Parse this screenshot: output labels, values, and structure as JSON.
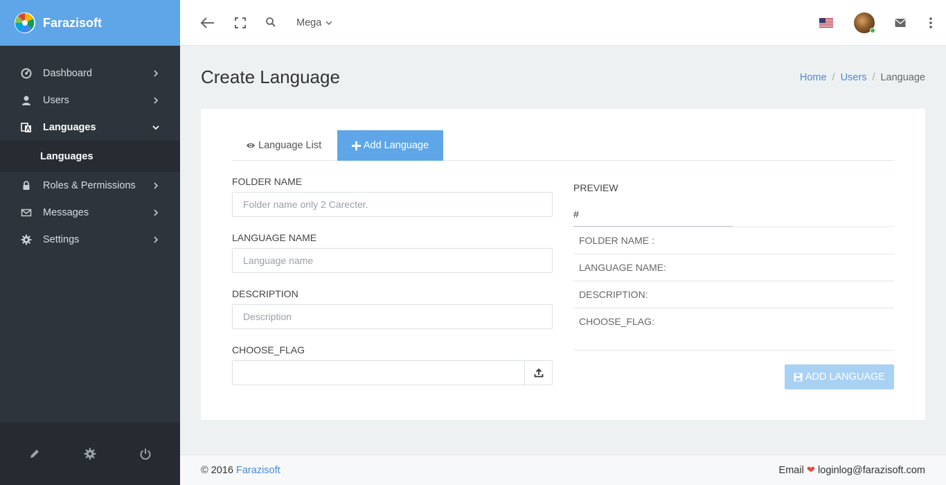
{
  "brand": {
    "name": "Farazisoft"
  },
  "sidebar": {
    "items": [
      {
        "label": "Dashboard",
        "icon": "dashboard-icon"
      },
      {
        "label": "Users",
        "icon": "user-icon"
      },
      {
        "label": "Languages",
        "icon": "language-icon",
        "active": true
      },
      {
        "label": "Roles & Permissions",
        "icon": "lock-icon"
      },
      {
        "label": "Messages",
        "icon": "envelope-icon"
      },
      {
        "label": "Settings",
        "icon": "gear-icon"
      }
    ],
    "sub_item": "Languages",
    "footer_icons": [
      "pencil-icon",
      "gear-icon",
      "power-icon"
    ]
  },
  "topbar": {
    "mega_label": "Mega"
  },
  "page": {
    "title": "Create Language"
  },
  "breadcrumb": {
    "home": "Home",
    "users": "Users",
    "current": "Language",
    "separator": "/"
  },
  "tabs": {
    "list": "Language List",
    "add": "Add Language"
  },
  "form": {
    "folder_label": "FOLDER NAME",
    "folder_placeholder": "Folder name only 2 Carecter.",
    "language_label": "LANGUAGE NAME",
    "language_placeholder": "Language name",
    "description_label": "DESCRIPTION",
    "description_placeholder": "Description",
    "flag_label": "CHOOSE_FLAG"
  },
  "preview": {
    "title": "PREVIEW",
    "hash": "#",
    "folder": "FOLDER NAME :",
    "language": "LANGUAGE NAME:",
    "description": "DESCRIPTION:",
    "flag": "CHOOSE_FLAG:"
  },
  "submit": {
    "label": "ADD LANGUAGE"
  },
  "footer": {
    "copyright": "© 2016",
    "company": "Farazisoft",
    "email_label": "Email",
    "email": "loginlog@farazisoft.com"
  },
  "colors": {
    "accent": "#5ea6e8",
    "sidebar": "#2e343b",
    "link": "#4a8ad6",
    "button_disabled": "#a9d1f3"
  }
}
